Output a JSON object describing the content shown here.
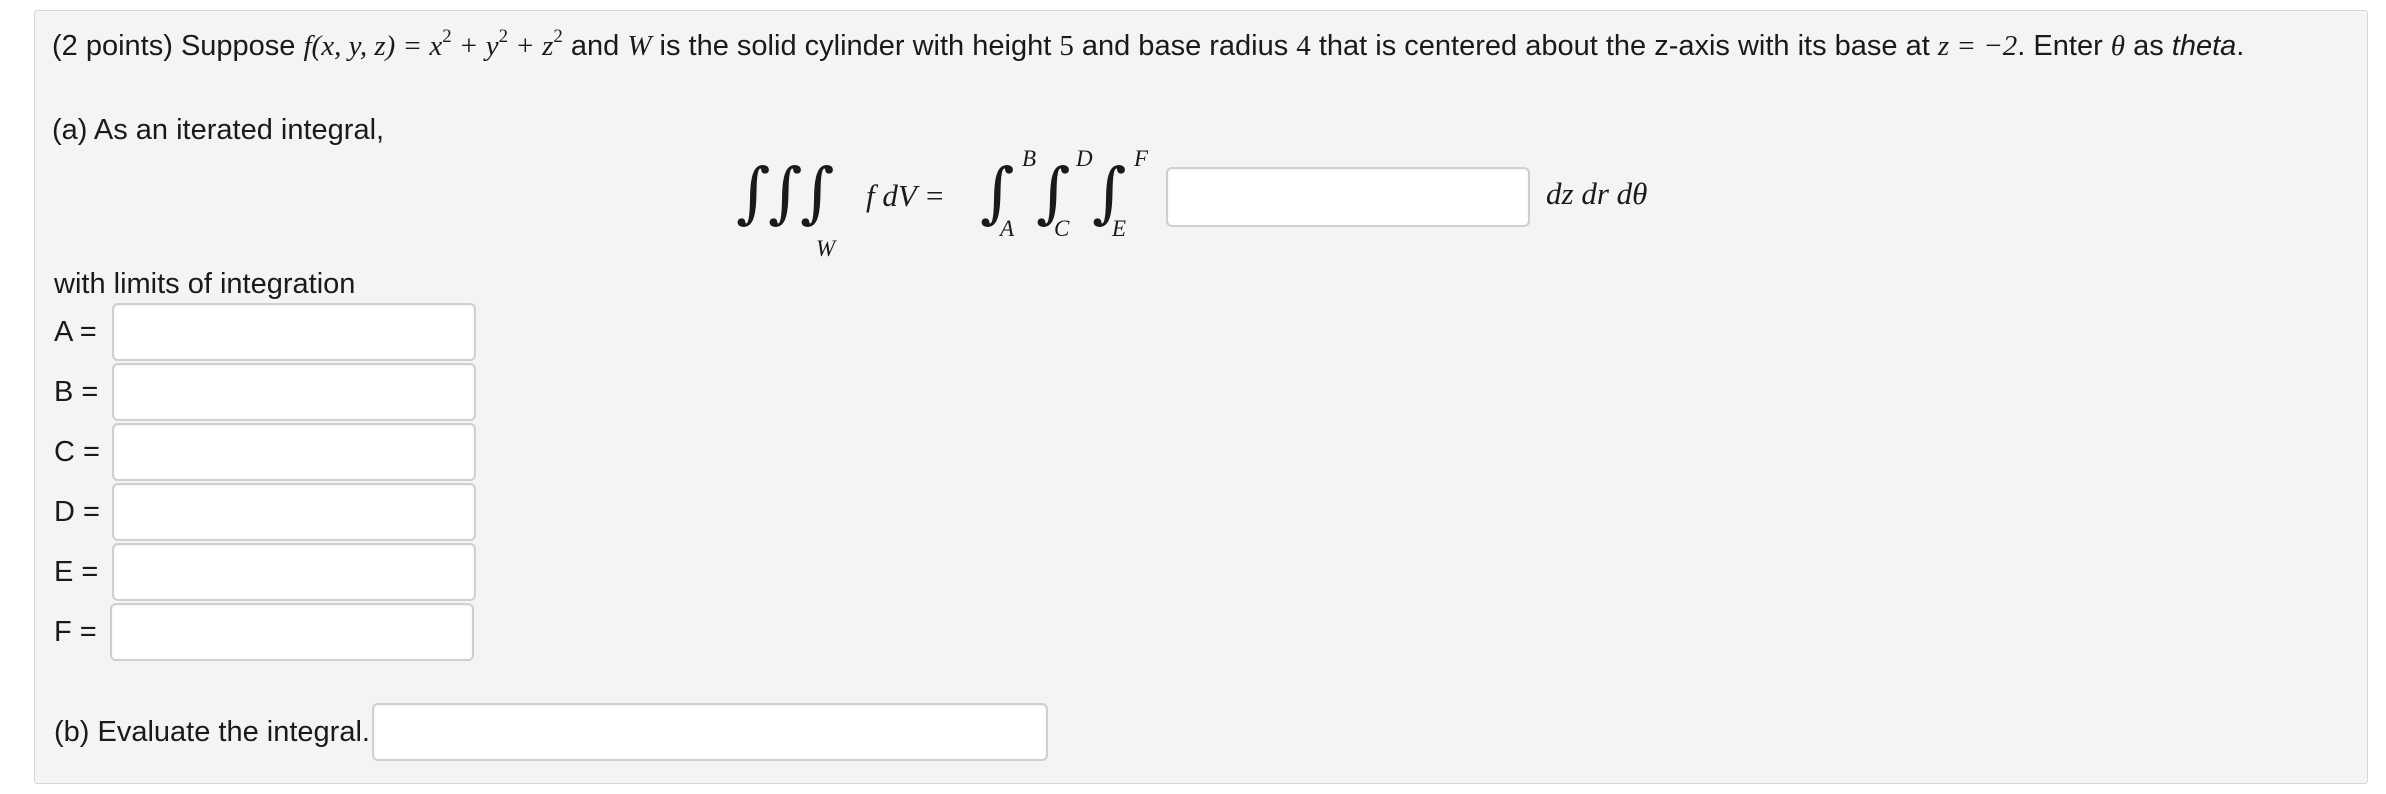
{
  "problem": {
    "prefix": "(2 points) Suppose ",
    "fn": "f(x, y, z)",
    "eq": " = x",
    "plus_y": " + y",
    "plus_z": " + z",
    "and_W": " and ",
    "W": "W",
    "desc1": " is the solid cylinder with height ",
    "height": "5",
    "desc2": " and base radius ",
    "radius": "4",
    "desc3": " that is centered about the z-axis with its base at ",
    "z_eq": "z = −2",
    "desc4": ". Enter ",
    "theta": "θ",
    "desc5": " as ",
    "theta_word": "theta",
    "desc6": ".",
    "exp2": "2"
  },
  "part_a": {
    "label": "(a) As an iterated integral,",
    "lhs_integrand": "f dV =",
    "lhs_region": "W",
    "limit_B": "B",
    "limit_A": "A",
    "limit_D": "D",
    "limit_C": "C",
    "limit_F": "F",
    "limit_E": "E",
    "differentials": "dz dr dθ",
    "integrand_input": {
      "value": "",
      "placeholder": ""
    }
  },
  "limits": {
    "heading": "with limits of integration",
    "rows": [
      {
        "label": "A =",
        "value": ""
      },
      {
        "label": "B =",
        "value": ""
      },
      {
        "label": "C =",
        "value": ""
      },
      {
        "label": "D =",
        "value": ""
      },
      {
        "label": "E =",
        "value": ""
      },
      {
        "label": "F =",
        "value": ""
      }
    ]
  },
  "part_b": {
    "label": "(b) Evaluate the integral.",
    "input": {
      "value": "",
      "placeholder": ""
    }
  }
}
